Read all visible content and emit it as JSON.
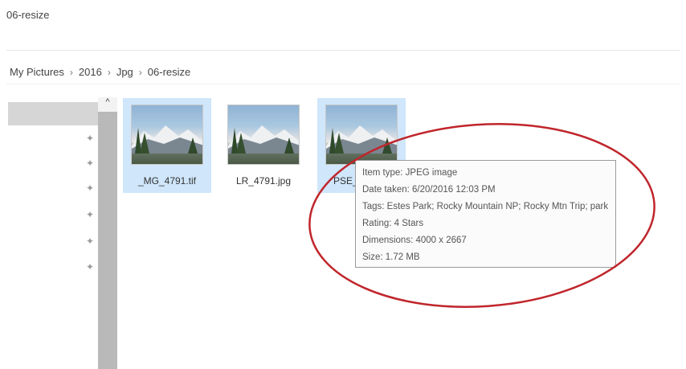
{
  "window": {
    "title": "06-resize"
  },
  "breadcrumb": [
    "My Pictures",
    "2016",
    "Jpg",
    "06-resize"
  ],
  "nav": {
    "scroll_up_glyph": "^"
  },
  "files": [
    {
      "name": "_MG_4791.tif",
      "selected": true
    },
    {
      "name": "LR_4791.jpg",
      "selected": false
    },
    {
      "name": "PSE_4",
      "selected": true
    }
  ],
  "tooltip": {
    "item_type": "Item type: JPEG image",
    "date_taken": "Date taken: 6/20/2016 12:03 PM",
    "tags": "Tags: Estes Park; Rocky Mountain NP; Rocky Mtn Trip; park",
    "rating": "Rating: 4 Stars",
    "dimensions": "Dimensions: 4000 x 2667",
    "size": "Size: 1.72 MB"
  },
  "colors": {
    "selection": "#cfe6fb",
    "annotation_circle": "#c0262c"
  },
  "icons": {
    "pin": "pin-icon",
    "scroll_up": "chevron-up-icon"
  }
}
